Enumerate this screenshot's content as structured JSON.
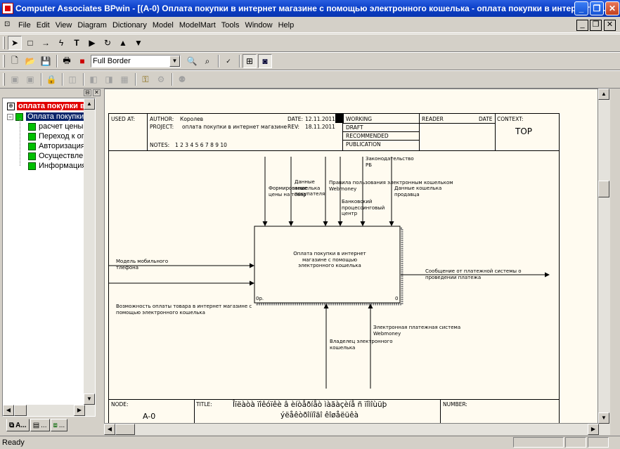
{
  "window": {
    "title": "Computer Associates BPwin - [(A-0) Оплата покупки  в интернет  магазине  с помощью  электронного кошелька  - оплата покупки в интернет ма..."
  },
  "menu": {
    "items": [
      "File",
      "Edit",
      "View",
      "Diagram",
      "Dictionary",
      "Model",
      "ModelMart",
      "Tools",
      "Window",
      "Help"
    ]
  },
  "toolbar": {
    "border_select": "Full Border"
  },
  "tree": {
    "root": "оплата покупки в",
    "selected": "Оплата покупки",
    "children": [
      "расчет цены т",
      "Переход к оп",
      "Авторизация",
      "Осуществлен",
      "Информация"
    ]
  },
  "tabs": [
    "A...",
    "...",
    "..."
  ],
  "frame": {
    "used_at": "USED AT:",
    "author_label": "AUTHOR:",
    "author": "Королев",
    "project_label": "PROJECT:",
    "project": "оплата покупки в интернет магазине",
    "notes_label": "NOTES:",
    "notes": "1  2  3  4  5  6  7  8  9  10",
    "date_label": "DATE:",
    "date": "12.11.2011",
    "rev_label": "REV:",
    "rev": "18.11.2011",
    "status": [
      "WORKING",
      "DRAFT",
      "RECOMMENDED",
      "PUBLICATION"
    ],
    "reader": "READER",
    "date2": "DATE",
    "context": "CONTEXT:",
    "top": "TOP",
    "node_label": "NODE:",
    "node": "A-0",
    "title_label": "TITLE:",
    "title_line1": "Îïëàòà ïîêóïêè  â èíòåðíåò  ìàãàçèíå ñ ïîìîùüþ",
    "title_line2": "ýëåêòðîííîãî êîøåëüêà",
    "number_label": "NUMBER:"
  },
  "diagram": {
    "box_text": "Оплата покупки  в интернет магазине с помощью электронного кошелька",
    "box_corner_left": "0р.",
    "box_corner_right": "0",
    "controls": [
      "Формирование цены на товар",
      "Данные кошелька покупателя",
      "Правила пользования электронным кошельком Webmoney",
      "Банковский процессинговый центр",
      "Законодательство РБ",
      "Данные кошелька продавца"
    ],
    "inputs": [
      "Модель мобильного тлефона",
      "Возможность оплаты товара в интернет магазине с помощью электронного кошелька"
    ],
    "output": "Сообщение от платежной системы о проведении платежа",
    "mechanisms": [
      "Владелец электронного кошелька",
      "Электронная платежная система Webmoney"
    ]
  },
  "status": {
    "text": "Ready"
  }
}
